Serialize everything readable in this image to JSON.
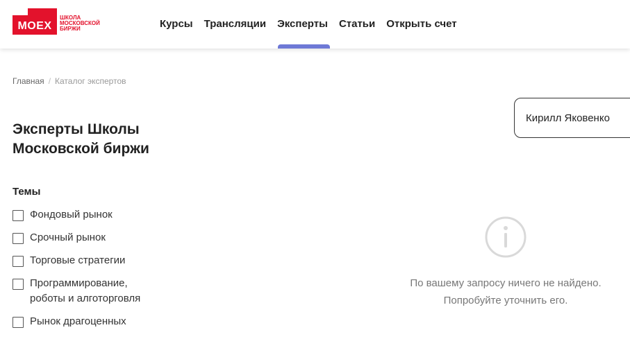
{
  "logo": {
    "wordmark": "MOEX",
    "lines": [
      "ШКОЛА",
      "МОСКОВСКОЙ",
      "БИРЖИ"
    ],
    "color": "#e3122c"
  },
  "nav": {
    "items": [
      "Курсы",
      "Трансляции",
      "Эксперты",
      "Статьи",
      "Открыть счет"
    ],
    "active": "Эксперты",
    "active_color": "#6e79d6"
  },
  "breadcrumb": {
    "home": "Главная",
    "separator": "/",
    "current": "Каталог экспертов"
  },
  "page": {
    "title_line1": "Эксперты Школы",
    "title_line2": "Московской биржи"
  },
  "filters": {
    "heading": "Темы",
    "items": [
      {
        "label_line1": "Фондовый рынок",
        "label_line2": "",
        "checked": false
      },
      {
        "label_line1": "Срочный рынок",
        "label_line2": "",
        "checked": false
      },
      {
        "label_line1": "Торговые стратегии",
        "label_line2": "",
        "checked": false
      },
      {
        "label_line1": "Программирование,",
        "label_line2": "роботы и алготорговля",
        "checked": false
      },
      {
        "label_line1": "Рынок драгоценных",
        "label_line2": "",
        "checked": false
      }
    ]
  },
  "search": {
    "value": "Кирилл Яковенко"
  },
  "empty_state": {
    "icon": "info-circle-icon",
    "line1": "По вашему запросу ничего не найдено.",
    "line2": "Попробуйте уточнить его."
  }
}
